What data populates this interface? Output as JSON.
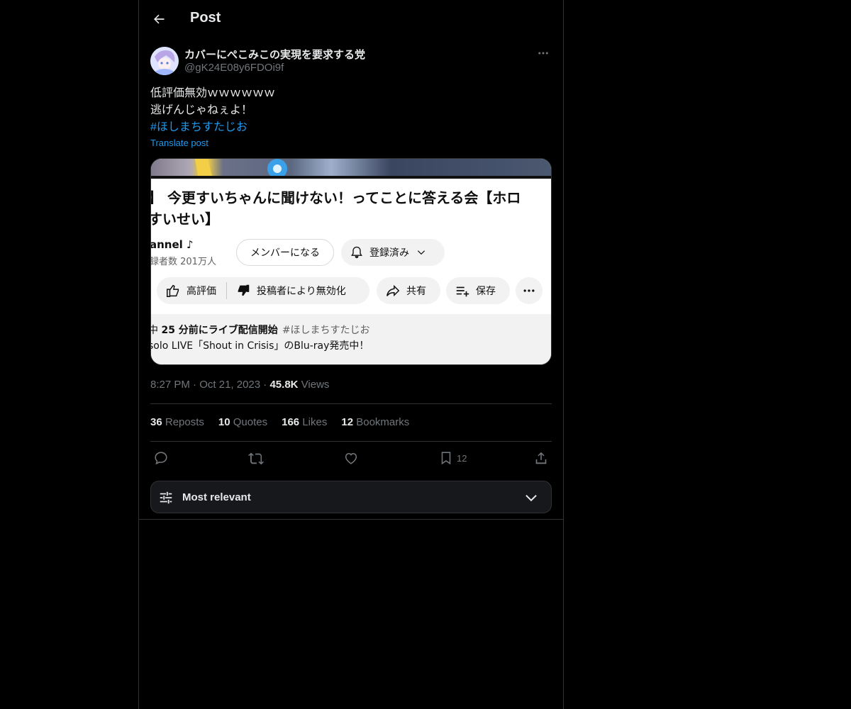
{
  "header": {
    "title": "Post"
  },
  "author": {
    "name": "カバーにぺこみこの実現を要求する党",
    "handle": "@gK24E08y6FDOi9f"
  },
  "post": {
    "line1": "低評価無効ｗｗｗｗｗｗ",
    "line2": "逃げんじゃねぇよ！",
    "hashtag": "#ほしまちすたじお",
    "translate_label": "Translate post"
  },
  "media": {
    "title_line1": "】 今更すいちゃんに聞けない！ってことに答える会【ホロ",
    "title_line2": "すいせい】",
    "channel": "annel ♪",
    "subscribers": "録者数 201万人",
    "member_label": "メンバーになる",
    "subscribed_label": "登録済み",
    "like_label": "高評価",
    "dislike_label": "投稿者により無効化",
    "share_label": "共有",
    "save_label": "保存",
    "desc_prefix": "中",
    "desc_bold": "25 分前にライブ配信開始",
    "desc_tag": "#ほしまちすたじお",
    "desc_line2": "solo LIVE「Shout in Crisis」のBlu-ray発売中！"
  },
  "meta": {
    "time": "8:27 PM",
    "sep1": "·",
    "date": "Oct 21, 2023",
    "sep2": "·",
    "views_count": "45.8K",
    "views_label": "Views"
  },
  "stats": {
    "reposts_count": "36",
    "reposts_label": "Reposts",
    "quotes_count": "10",
    "quotes_label": "Quotes",
    "likes_count": "166",
    "likes_label": "Likes",
    "bookmarks_count": "12",
    "bookmarks_label": "Bookmarks"
  },
  "actions": {
    "bookmark_count": "12"
  },
  "sort": {
    "label": "Most relevant"
  },
  "colors": {
    "accent": "#1d9bf0",
    "muted": "#71767b",
    "text": "#e7e9ea",
    "border": "#2f3336"
  },
  "icons": [
    "back-arrow-icon",
    "more-icon",
    "reply-icon",
    "repost-icon",
    "like-icon",
    "bookmark-icon",
    "share-icon",
    "sliders-icon",
    "chevron-down-icon"
  ]
}
